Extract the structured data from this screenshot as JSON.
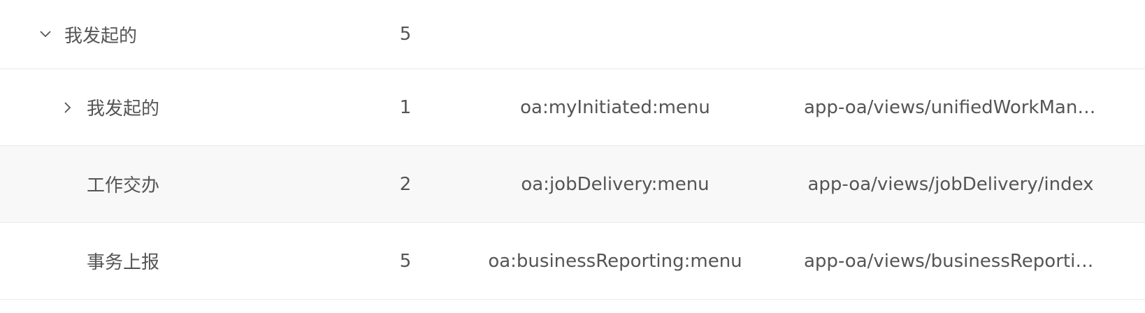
{
  "rows": [
    {
      "name": "我发起的",
      "order": "5",
      "permission": "",
      "component": "",
      "expanded": true,
      "level": 0
    },
    {
      "name": "我发起的",
      "order": "1",
      "permission": "oa:myInitiated:menu",
      "component": "app-oa/views/unifiedWorkMana…",
      "expanded": false,
      "level": 1
    },
    {
      "name": "工作交办",
      "order": "2",
      "permission": "oa:jobDelivery:menu",
      "component": "app-oa/views/jobDelivery/index",
      "level": 1
    },
    {
      "name": "事务上报",
      "order": "5",
      "permission": "oa:businessReporting:menu",
      "component": "app-oa/views/businessReportin…",
      "level": 1
    }
  ],
  "icons": {
    "expanded": "chevron-down-icon",
    "collapsed": "chevron-right-icon"
  },
  "colors": {
    "text": "#555555",
    "border": "#e8eaf0",
    "row_highlight": "#f8f8f8"
  }
}
